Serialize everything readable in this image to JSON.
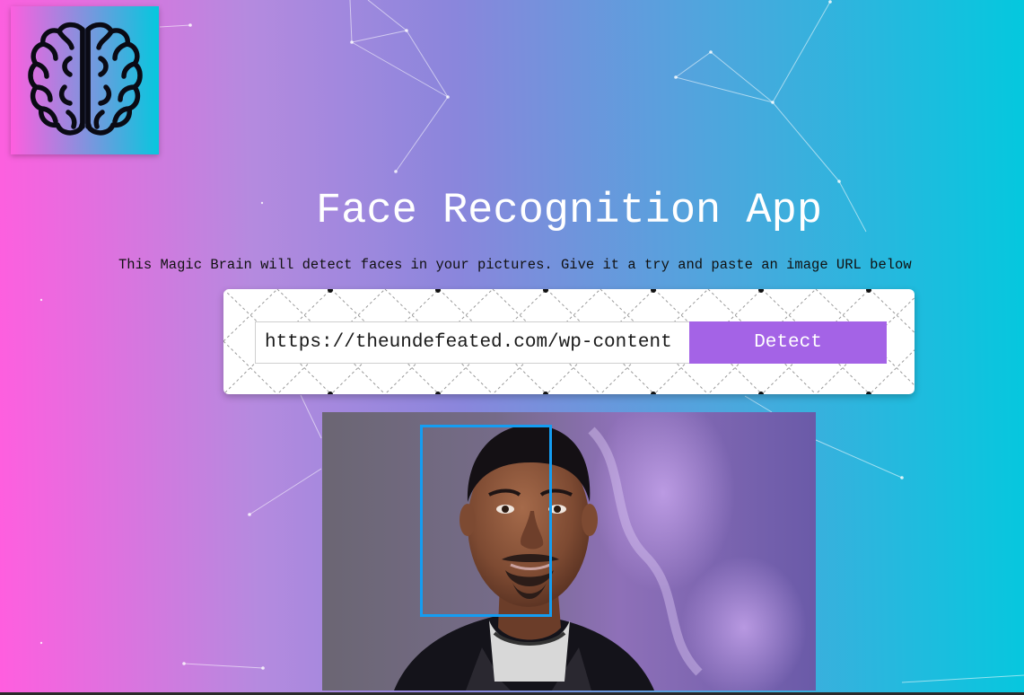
{
  "app": {
    "title": "Face Recognition App",
    "subtitle": "This Magic Brain will detect faces in your pictures. Give it a try and paste an image URL below"
  },
  "logo": {
    "icon": "brain-icon"
  },
  "form": {
    "url_value": "https://theundefeated.com/wp-content",
    "detect_label": "Detect"
  },
  "result": {
    "image_description_icon": "face-photo",
    "face_count_shown": 1
  },
  "colors": {
    "gradient_left": "#ff5edf",
    "gradient_right": "#04c8de",
    "button": "#a463e6",
    "face_box": "#149df2"
  }
}
